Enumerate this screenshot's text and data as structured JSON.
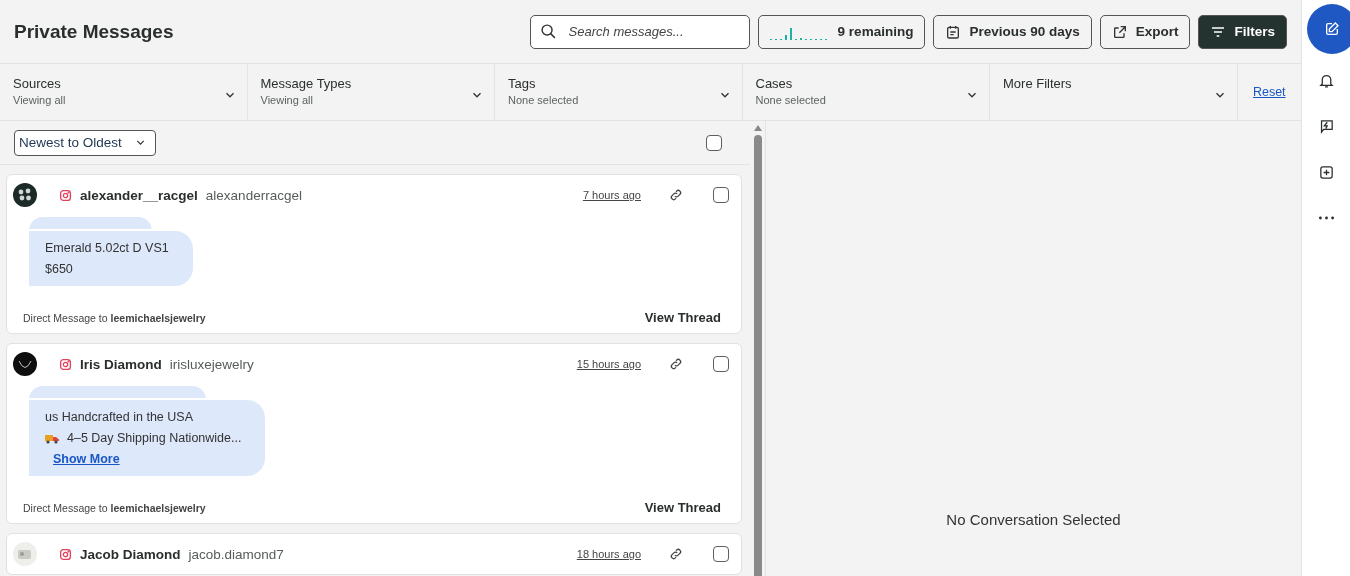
{
  "header": {
    "title": "Private Messages",
    "search": {
      "placeholder": "Search messages..."
    },
    "remaining": "9 remaining",
    "date_range": "Previous 90 days",
    "export": "Export",
    "filters": "Filters"
  },
  "filter_bar": {
    "filters": [
      {
        "label": "Sources",
        "value": "Viewing all"
      },
      {
        "label": "Message Types",
        "value": "Viewing all"
      },
      {
        "label": "Tags",
        "value": "None selected"
      },
      {
        "label": "Cases",
        "value": "None selected"
      },
      {
        "label": "More Filters"
      }
    ],
    "reset": "Reset"
  },
  "list": {
    "sort": "Newest to Oldest",
    "select_all": {
      "checked": false
    },
    "messages": [
      {
        "name": "alexander__racgel",
        "handle": "alexanderracgel",
        "time": "7 hours ago",
        "checked": false,
        "lines": [
          "Emerald 5.02ct D VS1",
          "$650"
        ],
        "footer": "Direct Message to **leemichaelsjewelry**",
        "action": "View Thread"
      },
      {
        "name": "Iris Diamond",
        "handle": "irisluxejewelry",
        "time": "15 hours ago",
        "checked": false,
        "lines": [
          "us Handcrafted in the USA",
          "4–5 Day Shipping Nationwide..."
        ],
        "show_more": "Show More",
        "footer": "Direct Message to **leemichaelsjewelry**",
        "action": "View Thread"
      },
      {
        "name": "Jacob Diamond",
        "handle": "jacob.diamond7",
        "time": "18 hours ago",
        "checked": false
      }
    ]
  },
  "detail": {
    "empty": "No Conversation Selected"
  },
  "rail": [
    {
      "selected": true
    },
    {
      "selected": false
    },
    {
      "selected": false
    },
    {
      "selected": false
    },
    {
      "selected": false
    }
  ]
}
